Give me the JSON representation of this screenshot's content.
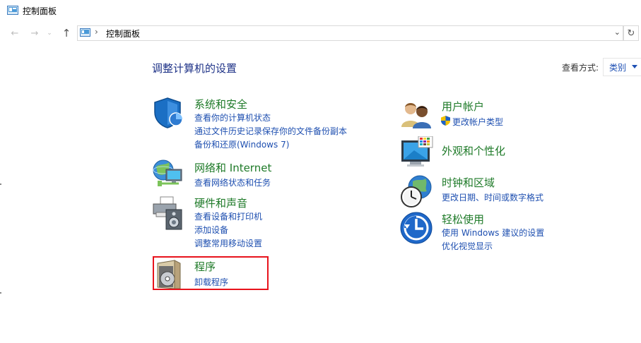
{
  "window": {
    "title": "控制面板"
  },
  "nav": {
    "back_icon": "arrow-left-icon",
    "forward_icon": "arrow-right-icon",
    "up_icon": "arrow-up-icon",
    "address_text": "控制面板",
    "separator": "›"
  },
  "main": {
    "heading": "调整计算机的设置",
    "view_by_label": "查看方式:",
    "view_by_value": "类别"
  },
  "categories": {
    "system_security": {
      "title": "系统和安全",
      "links": [
        "查看你的计算机状态",
        "通过文件历史记录保存你的文件备份副本",
        "备份和还原(Windows 7)"
      ]
    },
    "network": {
      "title": "网络和 Internet",
      "links": [
        "查看网络状态和任务"
      ]
    },
    "hardware": {
      "title": "硬件和声音",
      "links": [
        "查看设备和打印机",
        "添加设备",
        "调整常用移动设置"
      ]
    },
    "programs": {
      "title": "程序",
      "links": [
        "卸载程序"
      ]
    },
    "user_accounts": {
      "title": "用户帐户",
      "links": [
        "更改帐户类型"
      ]
    },
    "appearance": {
      "title": "外观和个性化",
      "links": []
    },
    "clock_region": {
      "title": "时钟和区域",
      "links": [
        "更改日期、时间或数字格式"
      ]
    },
    "ease_of_access": {
      "title": "轻松使用",
      "links": [
        "使用 Windows 建议的设置",
        "优化视觉显示"
      ]
    }
  },
  "colors": {
    "category_title": "#1e7a28",
    "link": "#1e4fb0",
    "heading": "#1e3287",
    "highlight": "#e8131c"
  }
}
